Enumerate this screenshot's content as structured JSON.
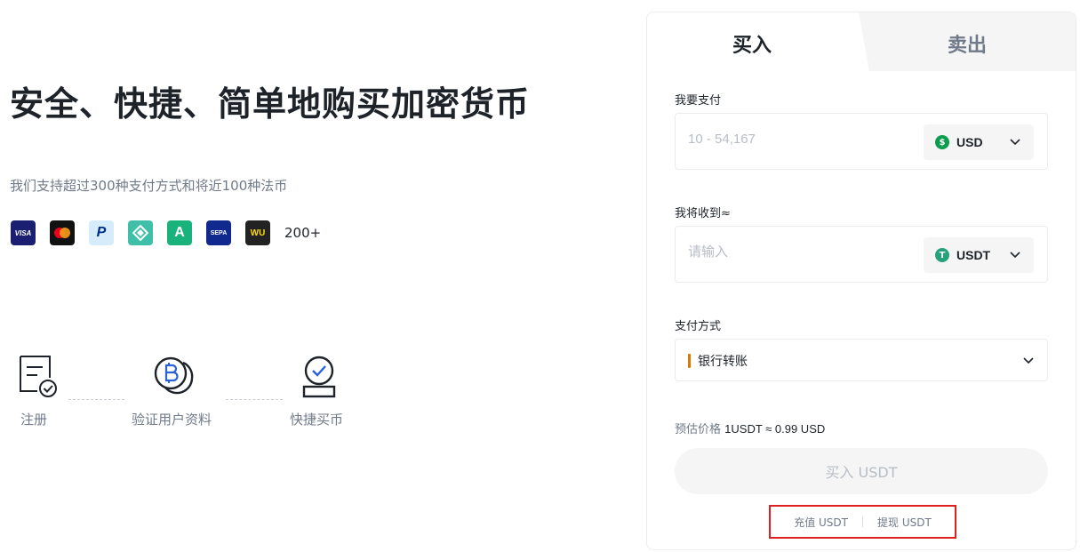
{
  "hero": {
    "title": "安全、快捷、简单地购买加密货币",
    "subtitle": "我们支持超过300种支付方式和将近100种法币"
  },
  "payment_icons": [
    {
      "name": "visa-icon",
      "text": "VISA"
    },
    {
      "name": "mastercard-icon",
      "text": ""
    },
    {
      "name": "paypal-icon",
      "text": "P"
    },
    {
      "name": "payment-app-icon",
      "text": ""
    },
    {
      "name": "cashapp-icon",
      "text": "A"
    },
    {
      "name": "sepa-icon",
      "text": "SEPA"
    },
    {
      "name": "western-union-icon",
      "text": "WU"
    }
  ],
  "payment_more": "200+",
  "steps": [
    {
      "label": "注册",
      "icon": "register-document-icon"
    },
    {
      "label": "验证用户资料",
      "icon": "verify-coin-icon"
    },
    {
      "label": "快捷买币",
      "icon": "quick-buy-icon"
    }
  ],
  "panel": {
    "tabs": {
      "buy": "买入",
      "sell": "卖出",
      "active": "buy"
    },
    "pay": {
      "label": "我要支付",
      "placeholder": "10 - 54,167",
      "value": "",
      "currency": "USD",
      "currency_icon": "dollar-icon",
      "currency_color": "#0b9d4d"
    },
    "receive": {
      "label": "我将收到≈",
      "placeholder": "请输入",
      "value": "",
      "currency": "USDT",
      "currency_icon": "tether-icon",
      "currency_color": "#26a17b"
    },
    "method": {
      "label": "支付方式",
      "value": "银行转账",
      "accent_color": "#d97a06"
    },
    "price": {
      "label": "预估价格",
      "value": "1USDT ≈ 0.99 USD"
    },
    "buy_button": "买入 USDT",
    "links": {
      "deposit": "充值 USDT",
      "withdraw": "提现 USDT"
    }
  }
}
